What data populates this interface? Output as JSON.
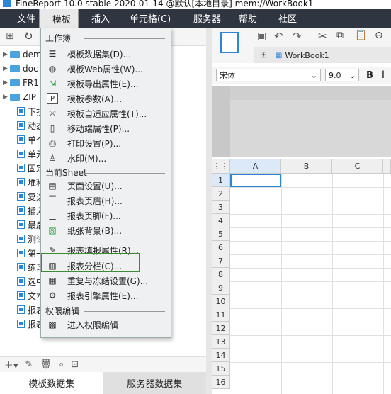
{
  "window": {
    "title": "FineReport 10.0 stable 2020-01-14 @默认[本地目录]   mem://WorkBook1"
  },
  "menubar": {
    "items": [
      "文件",
      "模板",
      "插入",
      "单元格(C)",
      "服务器",
      "帮助",
      "社区"
    ],
    "active_index": 1
  },
  "tree": {
    "folders": [
      "dem",
      "doc",
      "FR1",
      "ZIP"
    ],
    "files": [
      "下拉",
      "动态",
      "单个",
      "单元",
      "固定",
      "堆积",
      "复选",
      "插入",
      "最后",
      "测试",
      "第一",
      "练习",
      "选中",
      "文本",
      "报表",
      "报表"
    ]
  },
  "left_tabs": {
    "template": "模板数据集",
    "server": "服务器数据集"
  },
  "workbook_tab": "WorkBook1",
  "font": {
    "name": "宋体",
    "size": "9.0",
    "bold": "B"
  },
  "grid": {
    "columns": [
      "A",
      "B",
      "C"
    ],
    "rows": [
      "1",
      "2",
      "3",
      "4",
      "5",
      "6",
      "7",
      "8",
      "9",
      "10",
      "11",
      "12",
      "13",
      "14",
      "15",
      "16"
    ]
  },
  "dropdown": {
    "section_workbook": "工作簿",
    "workbook_items": [
      "模板数据集(D)...",
      "模板Web属性(W)...",
      "模板导出属性(E)...",
      "模板参数(A)...",
      "模板自适应属性(T)...",
      "移动端属性(P)...",
      "打印设置(P)...",
      "水印(M)..."
    ],
    "section_sheet": "当前Sheet",
    "sheet_items": [
      "页面设置(U)...",
      "报表页眉(H)...",
      "报表页脚(F)...",
      "纸张背景(B)...",
      "报表填报属性(R)...",
      "报表分栏(C)...",
      "重复与冻结设置(G)...",
      "报表引擎属性(E)..."
    ],
    "section_permission": "权限编辑",
    "permission_items": [
      "进入权限编辑"
    ],
    "highlighted": "报表分栏(C)..."
  }
}
